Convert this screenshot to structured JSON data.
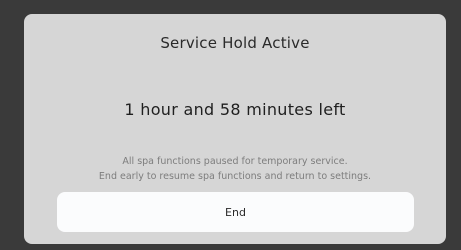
{
  "dialog": {
    "title": "Service Hold Active",
    "time_left": "1 hour and 58 minutes left",
    "message_line1": "All spa functions paused for temporary service.",
    "message_line2": "End early to resume spa functions and return to settings.",
    "end_button_label": "End"
  },
  "colors": {
    "backdrop": "#3a3a3a",
    "dialog_background": "#d6d6d6",
    "button_background": "#fbfcfd",
    "title_text": "#2a2a2a",
    "secondary_text": "#7d7d7d"
  }
}
